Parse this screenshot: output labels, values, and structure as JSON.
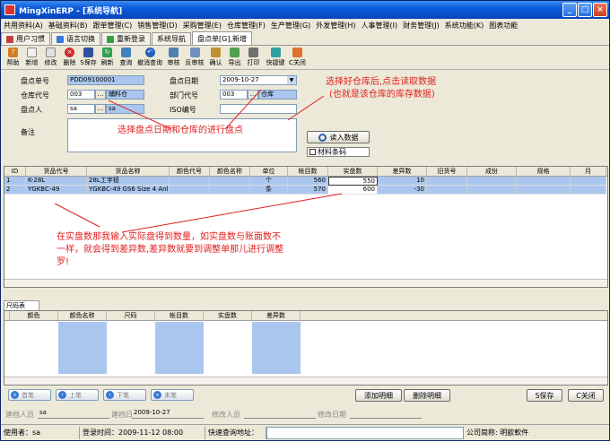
{
  "window": {
    "title": "MingXinERP - [系统导航]"
  },
  "menu": [
    "共用资料(A)",
    "基础资料(B)",
    "跟单管理(C)",
    "销售管理(D)",
    "采购管理(E)",
    "仓库管理(F)",
    "生产管理(G)",
    "外发管理(H)",
    "人事管理(I)",
    "财务管理(J)",
    "系统功能(K)",
    "图表功能"
  ],
  "tabs": [
    "用户习惯",
    "语言切换",
    "重新登录",
    "系统导航",
    "盘点单[G],新增"
  ],
  "toolbar": [
    "帮助",
    "新增",
    "修改",
    "删除",
    "S保存",
    "刷新",
    "查询",
    "撤消查询",
    "审核",
    "反审核",
    "确认",
    "导出",
    "打印",
    "快捷键",
    "C关闭"
  ],
  "form": {
    "doc_no_label": "盘点单号",
    "doc_no": "PDD09100001",
    "date_label": "盘点日期",
    "date": "2009-10-27",
    "warehouse_label": "仓库代号",
    "warehouse_code": "003",
    "warehouse_name": "辅料仓",
    "dept_label": "部门代号",
    "dept_code": "003",
    "dept_name": "仓库",
    "person_label": "盘点人",
    "person_code": "sa",
    "person_name": "sa",
    "iso_label": "ISO编号",
    "iso": "",
    "remark_label": "备注",
    "remark": "",
    "read_button": "读入数据",
    "barcode_label": "材料条码"
  },
  "annotations": {
    "top": "选择好仓库后,点击读取数据",
    "top2": "(也就是该仓库的库存数据)",
    "middle": "选择盘点日期和仓库的进行盘点",
    "bottom1": "在实盘数那我输入实际盘得到数量，如实盘数与账面数不",
    "bottom2": "一样，就会得到差异数,差异数就要到调整单那儿进行调整",
    "bottom3": "罗!"
  },
  "main_grid": {
    "columns": [
      "ID",
      "货品代号",
      "货品名称",
      "颜色代号",
      "颜色名称",
      "单位",
      "帐目数",
      "实盘数",
      "差异数",
      "旧货号",
      "成份",
      "规格",
      "月"
    ],
    "rows": [
      [
        "1",
        "K-28L",
        "28L工字钮",
        "",
        "",
        "个",
        "560",
        "550",
        "10",
        "",
        "",
        "",
        ""
      ],
      [
        "2",
        "YGKBC-49",
        "YGKBC-49 GS6 Size 4 Anl",
        "",
        "",
        "条",
        "570",
        "600",
        "-30",
        "",
        "",
        "",
        ""
      ]
    ]
  },
  "size_grid": {
    "tab": "尺码表",
    "columns": [
      "颜色",
      "颜色名称",
      "尺码",
      "帐目数",
      "实盘数",
      "差异数"
    ]
  },
  "nav": [
    "首笔",
    "上笔",
    "下笔",
    "末笔"
  ],
  "detail_buttons": {
    "add": "添加明细",
    "delete": "删除明细",
    "save": "S保存",
    "close": "C关闭"
  },
  "footer": {
    "creator_label": "建档人员",
    "creator": "sa",
    "create_date_label": "建档日期",
    "create_date": "2009-10-27",
    "modifier_label": "修改人员",
    "modifier": "",
    "modify_date_label": "修改日期",
    "modify_date": ""
  },
  "status": {
    "user": "使用者：sa",
    "login": "登录时间：2009-11-12 08:00",
    "query": "快速查询地址：",
    "company": "公司简称: 明歆軟件"
  }
}
